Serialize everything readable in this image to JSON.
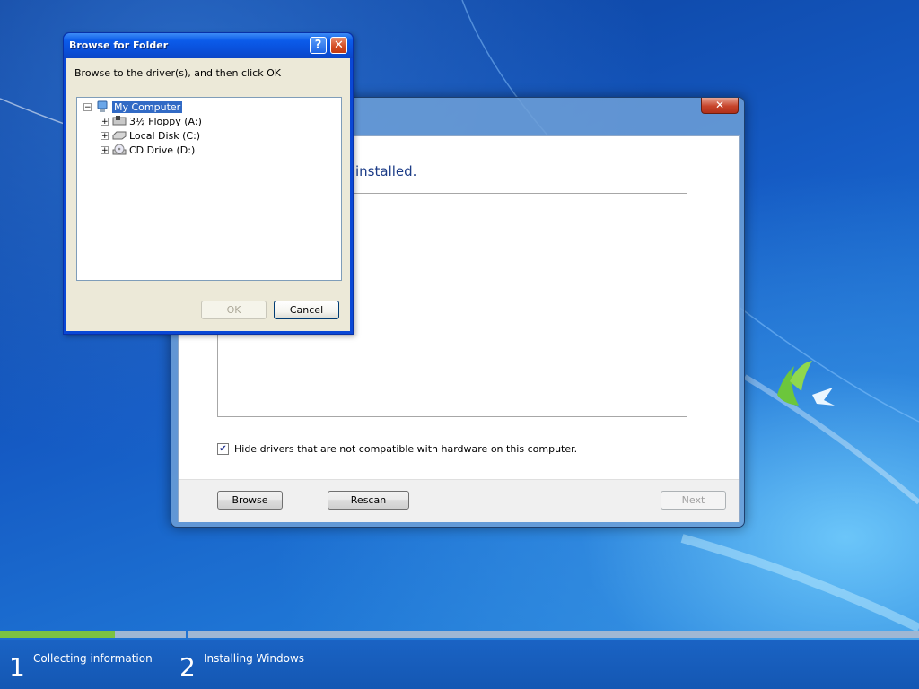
{
  "browse_dialog": {
    "title": "Browse for Folder",
    "help_label": "?",
    "close_label": "✕",
    "instruction": "Browse to the driver(s), and then click OK",
    "tree": [
      {
        "label": "My Computer",
        "expander": "−",
        "icon": "computer-icon",
        "selected": true
      },
      {
        "label": "3½ Floppy (A:)",
        "expander": "+",
        "icon": "floppy-drive-icon"
      },
      {
        "label": "Local Disk (C:)",
        "expander": "+",
        "icon": "hard-disk-icon"
      },
      {
        "label": "CD Drive (D:)",
        "expander": "+",
        "icon": "cd-drive-icon"
      }
    ],
    "ok_label": "OK",
    "cancel_label": "Cancel"
  },
  "main_dialog": {
    "close_label": "✕",
    "heading_visible": "installed.",
    "hide_checkbox_label": "Hide drivers that are not compatible with hardware on this computer.",
    "hide_checkbox_checked": true,
    "check_mark": "✔",
    "browse_label": "Browse",
    "rescan_label": "Rescan",
    "next_label": "Next"
  },
  "setup_progress": {
    "steps": [
      {
        "number": "1",
        "label": "Collecting information",
        "progress": 0.62
      },
      {
        "number": "2",
        "label": "Installing Windows",
        "progress": 0
      }
    ]
  },
  "colors": {
    "xp_title_blue": "#0b5bea",
    "selection_blue": "#316ac5",
    "progress_green": "#7cc242",
    "win7_heading": "#1c3c87"
  }
}
